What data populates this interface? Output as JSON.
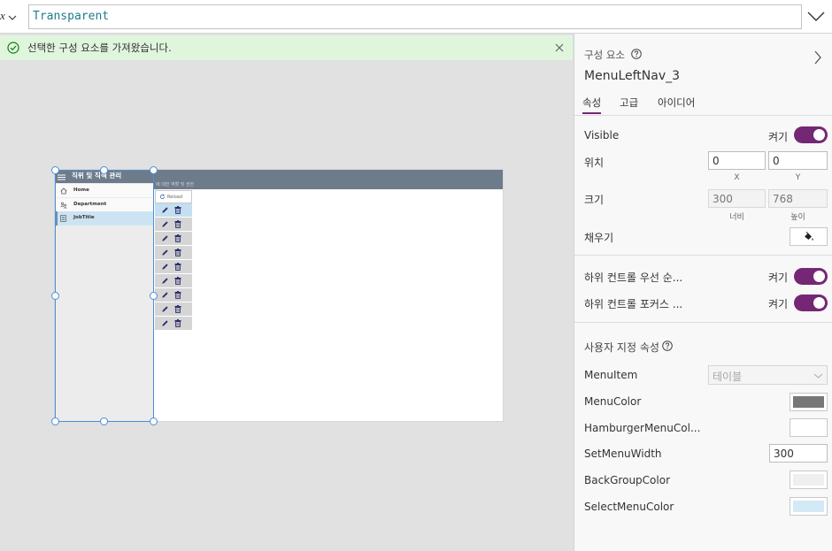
{
  "formula_bar": {
    "property_fragment": "x",
    "property_chevron_icon": "chevron-down-icon",
    "value": "Transparent",
    "expand_icon": "chevron-down-icon"
  },
  "notification": {
    "icon": "check-circle-icon",
    "message": "선택한 구성 요소를 가져왔습니다.",
    "close_icon": "close-icon"
  },
  "preview": {
    "header": {
      "menu_icon": "hamburger-icon",
      "title": "직위 및 직책 관리",
      "subtitle": "에 대한 역할 및 권한",
      "color": "#6e7b8b"
    },
    "nav": {
      "items": [
        {
          "icon": "home-icon",
          "label": "Home",
          "selected": false
        },
        {
          "icon": "people-icon",
          "label": "Department",
          "selected": false
        },
        {
          "icon": "document-icon",
          "label": "JobTitle",
          "selected": true
        }
      ]
    },
    "gallery": {
      "reload_icon": "refresh-icon",
      "reload_label": "Reload",
      "rows": [
        {
          "edit_icon": "pencil-icon",
          "delete_icon": "trash-icon",
          "selected": true
        },
        {
          "edit_icon": "pencil-icon",
          "delete_icon": "trash-icon",
          "selected": false
        },
        {
          "edit_icon": "pencil-icon",
          "delete_icon": "trash-icon",
          "selected": false
        },
        {
          "edit_icon": "pencil-icon",
          "delete_icon": "trash-icon",
          "selected": false
        },
        {
          "edit_icon": "pencil-icon",
          "delete_icon": "trash-icon",
          "selected": false
        },
        {
          "edit_icon": "pencil-icon",
          "delete_icon": "trash-icon",
          "selected": false
        },
        {
          "edit_icon": "pencil-icon",
          "delete_icon": "trash-icon",
          "selected": false
        },
        {
          "edit_icon": "pencil-icon",
          "delete_icon": "trash-icon",
          "selected": false
        },
        {
          "edit_icon": "pencil-icon",
          "delete_icon": "trash-icon",
          "selected": false
        }
      ]
    }
  },
  "properties_panel": {
    "section_label": "구성 요소",
    "help_icon": "help-circle-icon",
    "collapse_icon": "chevron-right-icon",
    "component_name": "MenuLeftNav_3",
    "tabs": [
      {
        "label": "속성",
        "active": true
      },
      {
        "label": "고급",
        "active": false
      },
      {
        "label": "아이디어",
        "active": false
      }
    ],
    "visible": {
      "label": "Visible",
      "state_label": "켜기",
      "on": true
    },
    "position": {
      "label": "위치",
      "x": "0",
      "y": "0",
      "x_label": "X",
      "y_label": "Y"
    },
    "size": {
      "label": "크기",
      "width": "300",
      "height": "768",
      "width_label": "너비",
      "height_label": "높이"
    },
    "fill": {
      "label": "채우기",
      "icon": "paint-bucket-icon",
      "color": "#ffffff"
    },
    "child_priority": {
      "label": "하위 컨트롤 우선 순...",
      "state_label": "켜기",
      "on": true
    },
    "child_focus": {
      "label": "하위 컨트롤 포커스 ...",
      "state_label": "켜기",
      "on": true
    },
    "custom": {
      "title": "사용자 지정 속성",
      "help_icon": "help-circle-icon",
      "menu_item": {
        "label": "MenuItem",
        "value": "테이블"
      },
      "menu_color": {
        "label": "MenuColor",
        "color": "#777777"
      },
      "hamburger_color": {
        "label": "HamburgerMenuCol...",
        "color": "#ffffff"
      },
      "set_menu_width": {
        "label": "SetMenuWidth",
        "value": "300"
      },
      "back_group_color": {
        "label": "BackGroupColor",
        "color": "#efefef"
      },
      "select_menu_color": {
        "label": "SelectMenuColor",
        "color": "#d3e9f6"
      }
    }
  },
  "colors": {
    "accent": "#742774",
    "selection": "#4a8fd8",
    "notification_bg": "#dff6dd",
    "formula_text": "#1f7c8c"
  }
}
